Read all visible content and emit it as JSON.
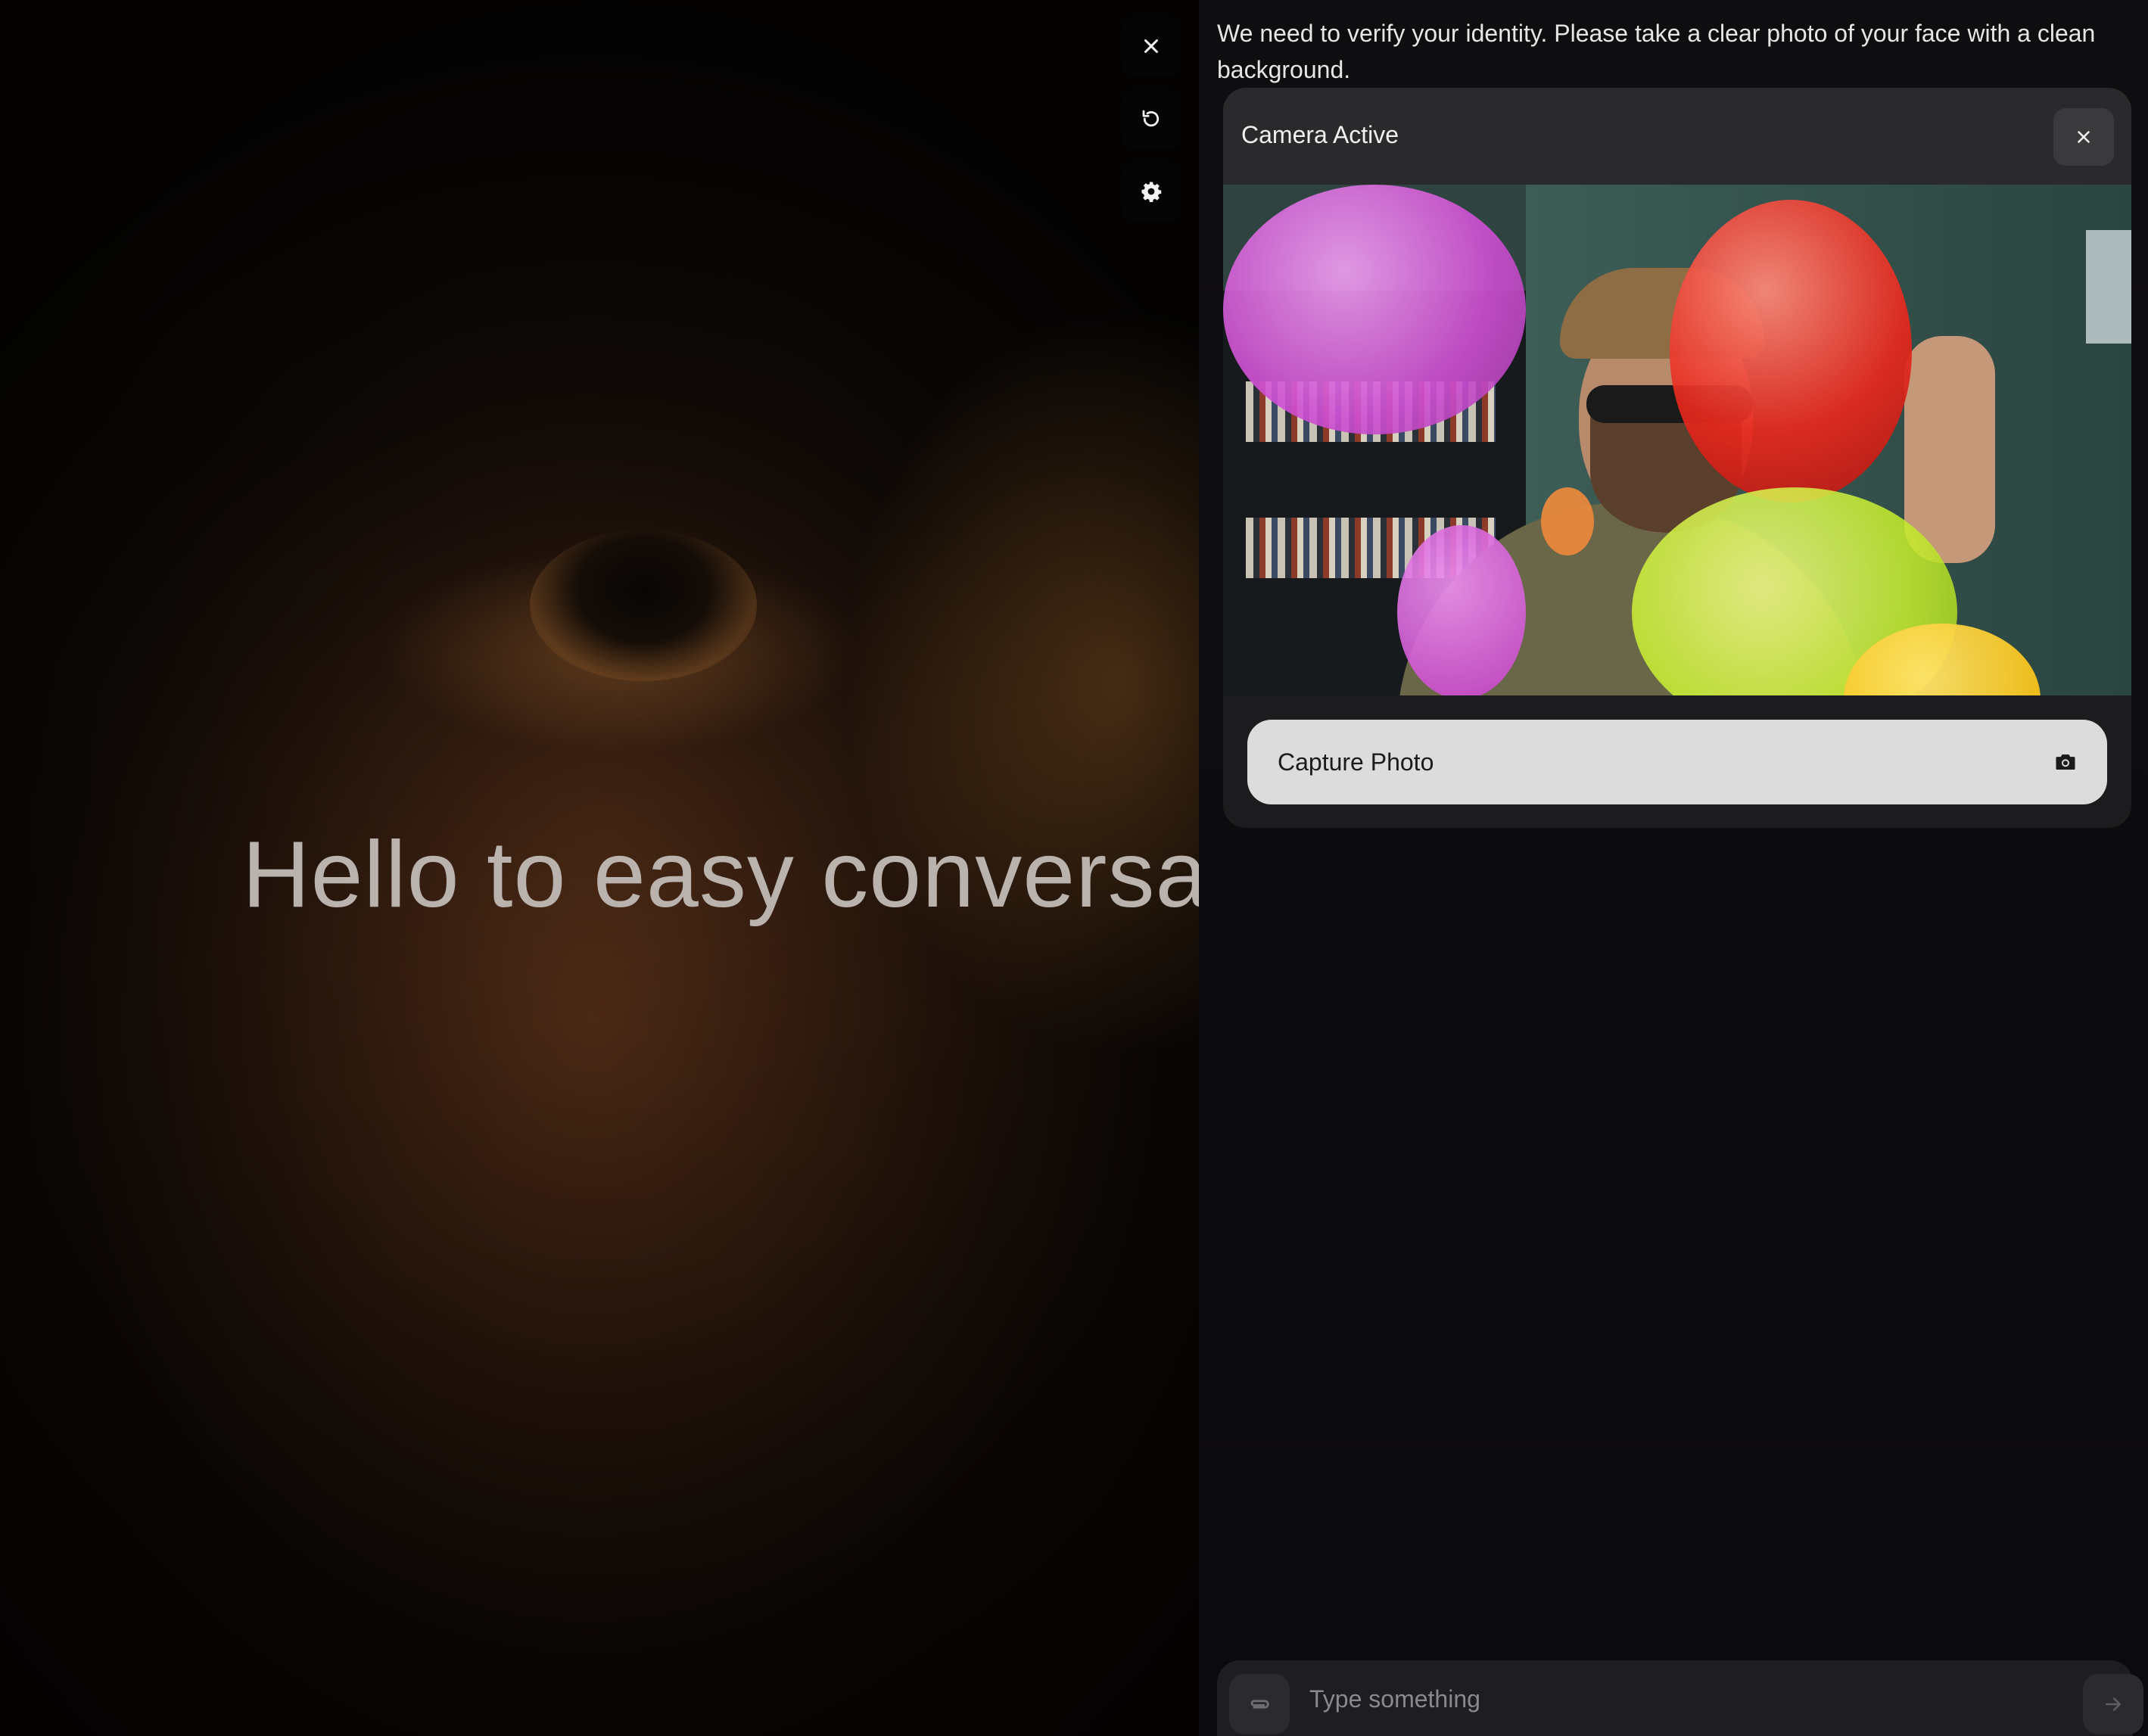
{
  "hero": {
    "title": "Hello to easy conversati",
    "tools": [
      {
        "icon": "close-icon"
      },
      {
        "icon": "refresh-icon"
      },
      {
        "icon": "gear-icon"
      }
    ]
  },
  "chat": {
    "message": "We need to verify your identity. Please take a clear photo of your face with a clean background.",
    "camera": {
      "title": "Camera Active",
      "close_icon": "close-icon",
      "capture_label": "Capture Photo",
      "capture_icon": "camera-icon"
    },
    "composer": {
      "placeholder": "Type something",
      "value": "",
      "attach_icon": "paperclip-icon",
      "send_icon": "arrow-right-icon"
    }
  },
  "colors": {
    "panel_bg": "#0b0a0c",
    "card_bg": "#1c1c1e",
    "card_header_bg": "#2a2a2c",
    "capture_button_bg": "#dcdcdc",
    "hero_text": "#b9b2ad"
  }
}
